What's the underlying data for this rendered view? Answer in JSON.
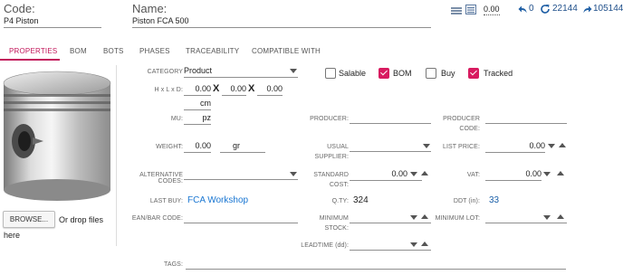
{
  "header": {
    "code_label": "Code:",
    "code_value": "P4 Piston",
    "name_label": "Name:",
    "name_value": "Piston FCA 500",
    "price_value": "0.00",
    "undo_count": "0",
    "refresh_count": "22144",
    "redo_count": "105144"
  },
  "tabs": [
    "PROPERTIES",
    "BOM",
    "BOTS",
    "PHASES",
    "TRACEABILITY",
    "COMPATIBLE WITH"
  ],
  "image_panel": {
    "browse_label": "BROWSE...",
    "drop_text_1": "Or drop files",
    "drop_text_2": "here"
  },
  "form": {
    "category_label": "CATEGORY",
    "category_value": "Product",
    "hxlxd_label": "H x L x D:",
    "dim_h": "0.00",
    "dim_l": "0.00",
    "dim_d": "0.00",
    "dim_sep_1": "X",
    "dim_sep_2": "X",
    "dim_unit": "cm",
    "mu_label": "MU:",
    "mu_value": "pz",
    "weight_label": "WEIGHT:",
    "weight_value": "0.00",
    "weight_unit": "gr",
    "alt_codes_label": "ALTERNATIVE CODES:",
    "last_buy_label": "LAST BUY:",
    "last_buy_value": "FCA Workshop",
    "ean_label": "EAN/BAR CODE:",
    "tags_label": "TAGS:",
    "producer_label": "PRODUCER:",
    "usual_supplier_label_1": "USUAL",
    "usual_supplier_label_2": "SUPPLIER:",
    "standard_cost_label_1": "STANDARD",
    "standard_cost_label_2": "COST:",
    "standard_cost_value": "0.00",
    "qty_label": "Q.TY:",
    "qty_value": "324",
    "min_stock_label_1": "MINIMUM",
    "min_stock_label_2": "STOCK:",
    "leadtime_label": "LEADTIME (dd):",
    "producer_code_label_1": "PRODUCER",
    "producer_code_label_2": "CODE:",
    "list_price_label": "LIST PRICE:",
    "list_price_value": "0.00",
    "vat_label": "VAT:",
    "vat_value": "0.00",
    "ddt_label": "DDT (in):",
    "ddt_value": "33",
    "min_lot_label": "MINIMUM LOT:"
  },
  "checkboxes": [
    {
      "label": "Salable",
      "checked": false
    },
    {
      "label": "BOM",
      "checked": true
    },
    {
      "label": "Buy",
      "checked": false
    },
    {
      "label": "Tracked",
      "checked": true
    }
  ],
  "colors": {
    "accent": "#c2185b",
    "checkbox_on": "#d81b60",
    "link": "#1976d2"
  }
}
